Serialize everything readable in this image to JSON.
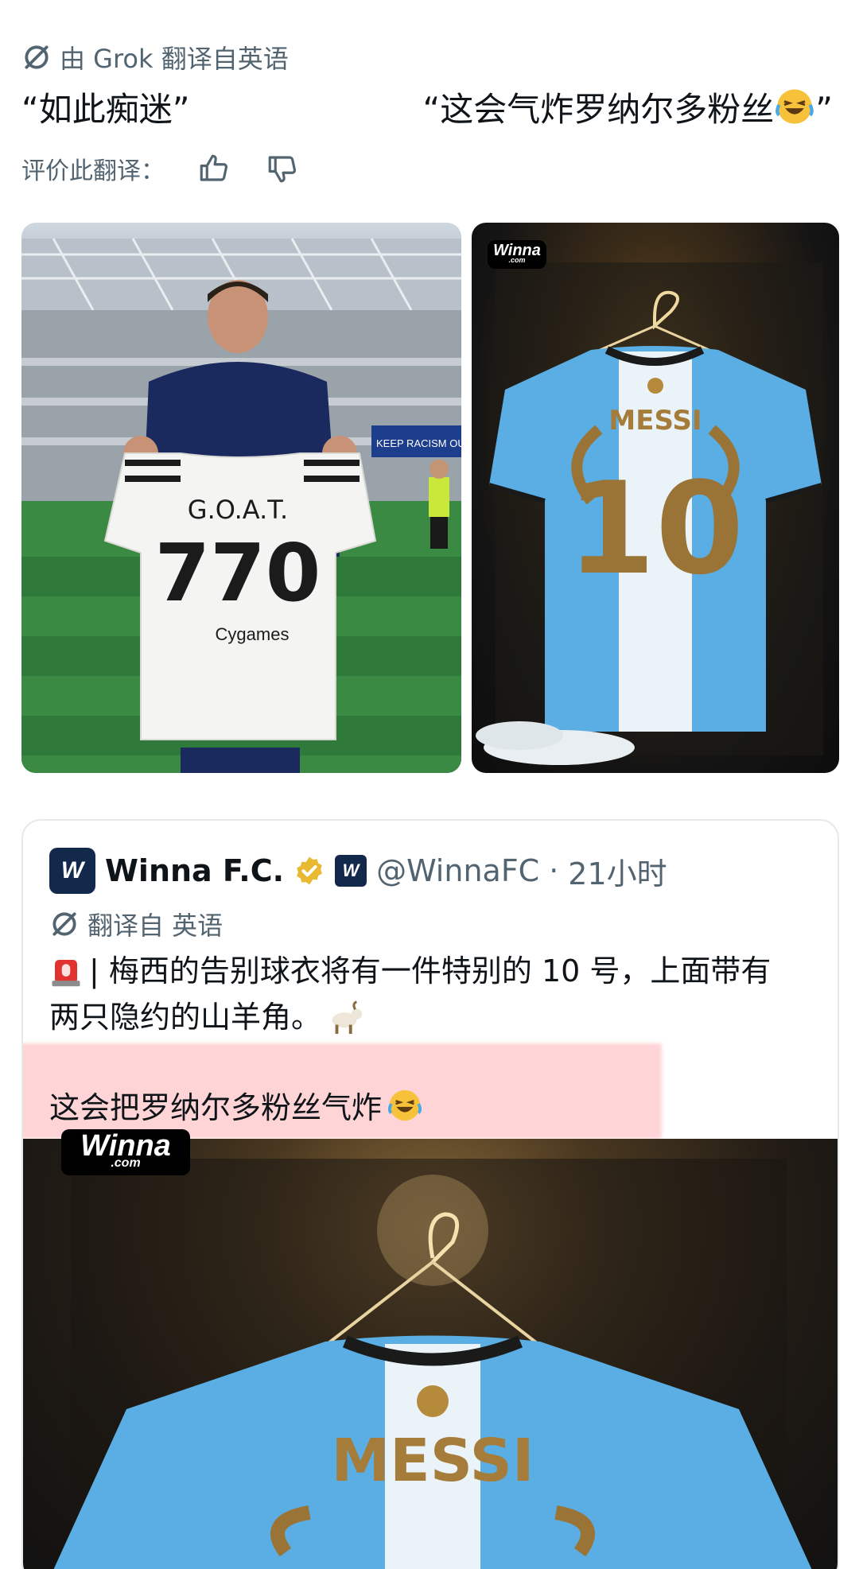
{
  "translation_note": {
    "text": "由 Grok 翻译自英语"
  },
  "quotes": {
    "left": "“如此痴迷”",
    "right": "“这会气炸罗纳尔多粉丝",
    "right_end": "”"
  },
  "rating": {
    "label": "评价此翻译："
  },
  "images": {
    "left": {
      "jersey_name": "G.O.A.T.",
      "jersey_number": "770",
      "sponsor": "Cygames",
      "board_text": "KEEP RACISM OUT"
    },
    "right": {
      "brand": "Winna",
      "brand_sub": ".com",
      "jersey_name": "MESSI",
      "jersey_number": "10"
    }
  },
  "quoted_tweet": {
    "name": "Winna F.C.",
    "handle": "@WinnaFC",
    "separator": "·",
    "time": "21小时",
    "translation_label": "翻译自 英语",
    "line1": "| 梅西的告别球衣将有一件特别的 10 号，上面带有",
    "line2": "两只隐约的山羊角。",
    "line3": "这会把罗纳尔多粉丝气炸",
    "image": {
      "brand": "Winna",
      "brand_sub": ".com",
      "jersey_name": "MESSI"
    }
  },
  "colors": {
    "muted": "#536471",
    "text": "#0f1419",
    "highlight": "#ffa0a5",
    "verified": "#e8b931"
  }
}
